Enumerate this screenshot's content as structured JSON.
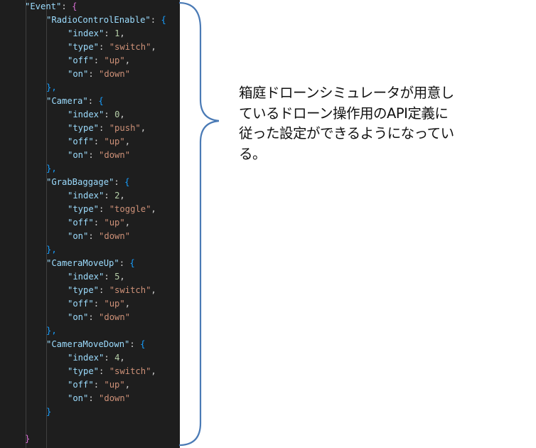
{
  "editor": {
    "event_key": "\"Event\"",
    "entries": [
      {
        "name": "\"RadioControlEnable\"",
        "index": "1",
        "type": "\"switch\"",
        "off": "\"up\"",
        "on": "\"down\""
      },
      {
        "name": "\"Camera\"",
        "index": "0",
        "type": "\"push\"",
        "off": "\"up\"",
        "on": "\"down\""
      },
      {
        "name": "\"GrabBaggage\"",
        "index": "2",
        "type": "\"toggle\"",
        "off": "\"up\"",
        "on": "\"down\""
      },
      {
        "name": "\"CameraMoveUp\"",
        "index": "5",
        "type": "\"switch\"",
        "off": "\"up\"",
        "on": "\"down\""
      },
      {
        "name": "\"CameraMoveDown\"",
        "index": "4",
        "type": "\"switch\"",
        "off": "\"up\"",
        "on": "\"down\""
      }
    ],
    "labels": {
      "index": "\"index\"",
      "type": "\"type\"",
      "off": "\"off\"",
      "on": "\"on\""
    }
  },
  "annotation": {
    "lines": [
      "箱庭ドローンシミュレータが用意し",
      "ているドローン操作用のAPI定義に",
      "従った設定ができるようになってい",
      "る。"
    ]
  },
  "colors": {
    "editor_bg": "#1e1e1e",
    "key": "#9cdcfe",
    "string": "#ce9178",
    "number": "#b5cea8",
    "brace_stroke": "#4a7ab5"
  }
}
